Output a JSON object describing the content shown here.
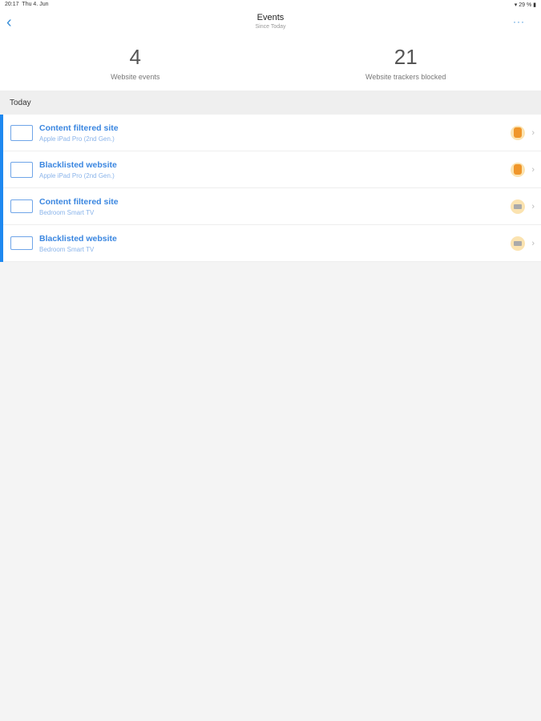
{
  "status": {
    "time": "20:17",
    "date": "Thu 4. Jun",
    "battery": "29 %"
  },
  "nav": {
    "title": "Events",
    "subtitle": "Since Today",
    "more": "···"
  },
  "stats": [
    {
      "value": "4",
      "label": "Website events"
    },
    {
      "value": "21",
      "label": "Website trackers blocked"
    }
  ],
  "section": "Today",
  "events": [
    {
      "title": "Content filtered site",
      "device": "Apple iPad Pro (2nd Gen.)",
      "type": "tablet",
      "avatar": "person"
    },
    {
      "title": "Blacklisted website",
      "device": "Apple iPad Pro (2nd Gen.)",
      "type": "tablet",
      "avatar": "person"
    },
    {
      "title": "Content filtered site",
      "device": "Bedroom Smart TV",
      "type": "tv",
      "avatar": "bed"
    },
    {
      "title": "Blacklisted website",
      "device": "Bedroom Smart TV",
      "type": "tv",
      "avatar": "bed"
    }
  ]
}
